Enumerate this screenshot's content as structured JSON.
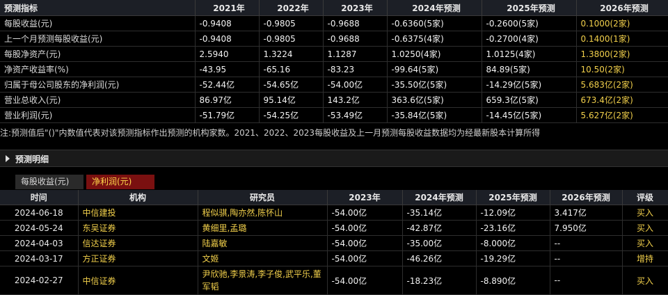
{
  "forecast": {
    "headers": [
      "预测指标",
      "2021年",
      "2022年",
      "2023年",
      "2024年预测",
      "2025年预测",
      "2026年预测"
    ],
    "rows": [
      {
        "label": "每股收益(元)",
        "cells": [
          "-0.9408",
          "-0.9805",
          "-0.9688",
          "-0.6360(5家)",
          "-0.2600(5家)",
          "0.1000(2家)"
        ]
      },
      {
        "label": "上一个月预测每股收益(元)",
        "cells": [
          "-0.9408",
          "-0.9805",
          "-0.9688",
          "-0.6375(4家)",
          "-0.2700(4家)",
          "0.1400(1家)"
        ]
      },
      {
        "label": "每股净资产(元)",
        "cells": [
          "2.5940",
          "1.3224",
          "1.1287",
          "1.0250(4家)",
          "1.0125(4家)",
          "1.3800(2家)"
        ]
      },
      {
        "label": "净资产收益率(%)",
        "cells": [
          "-43.95",
          "-65.16",
          "-83.23",
          "-99.64(5家)",
          "84.89(5家)",
          "10.50(2家)"
        ]
      },
      {
        "label": "归属于母公司股东的净利润(元)",
        "cells": [
          "-52.44亿",
          "-54.65亿",
          "-54.00亿",
          "-35.50亿(5家)",
          "-14.29亿(5家)",
          "5.683亿(2家)"
        ]
      },
      {
        "label": "营业总收入(元)",
        "cells": [
          "86.97亿",
          "95.14亿",
          "143.2亿",
          "363.6亿(5家)",
          "659.3亿(5家)",
          "673.4亿(2家)"
        ]
      },
      {
        "label": "营业利润(元)",
        "cells": [
          "-51.79亿",
          "-54.25亿",
          "-53.49亿",
          "-35.84亿(5家)",
          "-14.45亿(5家)",
          "5.627亿(2家)"
        ]
      }
    ]
  },
  "note": "注:预测值后\"()\"内数值代表对该预测指标作出预测的机构家数。2021、2022、2023每股收益及上一月预测每股收益数据均为经最新股本计算所得",
  "detail_section": {
    "title": "预测明细"
  },
  "tabs": [
    {
      "label": "每股收益(元)",
      "active": false
    },
    {
      "label": "净利润(元)",
      "active": true
    }
  ],
  "detail": {
    "headers": [
      "时间",
      "机构",
      "研究员",
      "2023年",
      "2024年预测",
      "2025年预测",
      "2026年预测",
      "评级"
    ],
    "rows": [
      {
        "date": "2024-06-18",
        "institution": "中信建投",
        "analysts": "程似骐,陶亦然,陈怀山",
        "y2023": "-54.00亿",
        "y2024": "-35.14亿",
        "y2025": "-12.09亿",
        "y2026": "3.417亿",
        "rating": "买入"
      },
      {
        "date": "2024-05-24",
        "institution": "东吴证券",
        "analysts": "黄细里,孟璐",
        "y2023": "-54.00亿",
        "y2024": "-42.87亿",
        "y2025": "-23.16亿",
        "y2026": "7.950亿",
        "rating": "买入"
      },
      {
        "date": "2024-04-03",
        "institution": "信达证券",
        "analysts": "陆嘉敏",
        "y2023": "-54.00亿",
        "y2024": "-35.00亿",
        "y2025": "-8.000亿",
        "y2026": "--",
        "rating": "买入"
      },
      {
        "date": "2024-03-17",
        "institution": "方正证券",
        "analysts": "文姬",
        "y2023": "-54.00亿",
        "y2024": "-46.26亿",
        "y2025": "-19.29亿",
        "y2026": "--",
        "rating": "增持"
      },
      {
        "date": "2024-02-27",
        "institution": "中信证券",
        "analysts": "尹欣驰,李景涛,李子俊,武平乐,董军韬",
        "y2023": "-54.00亿",
        "y2024": "-18.23亿",
        "y2025": "-8.890亿",
        "y2026": "--",
        "rating": "买入"
      }
    ]
  },
  "colors": {
    "accent_yellow": "#f2d04b",
    "active_tab_bg": "#7a1010",
    "header_bg": "#1c1f26"
  }
}
